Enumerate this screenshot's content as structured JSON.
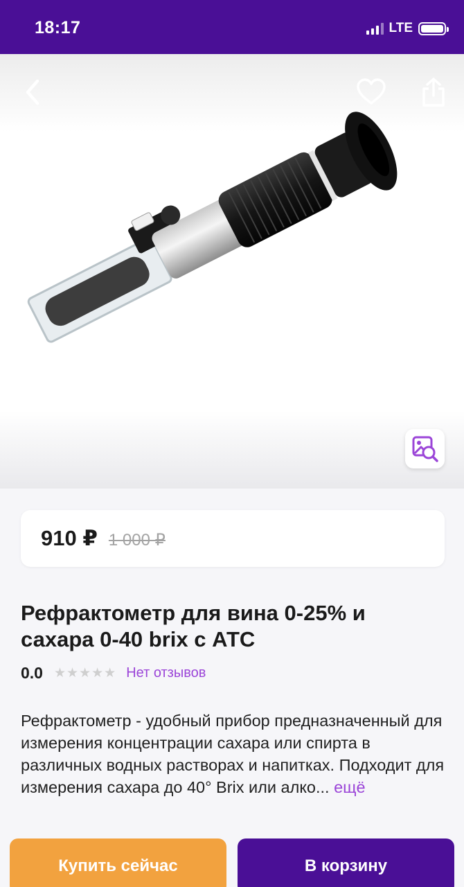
{
  "status_bar": {
    "time": "18:17",
    "network": "LTE",
    "battery_level": 1.0
  },
  "image_area": {
    "icons": {
      "back": "chevron-left-icon",
      "favorite": "heart-icon",
      "share": "share-icon",
      "visual_search": "image-search-icon"
    }
  },
  "price": {
    "current": "910 ₽",
    "old": "1 000 ₽"
  },
  "product": {
    "title": "Рефрактометр для вина 0-25% и сахара 0-40 brix с АТС",
    "rating": "0.0",
    "stars_filled": 0,
    "stars_total": 5,
    "reviews_label": "Нет отзывов",
    "description": "Рефрактометр - удобный прибор предназначенный для измерения концентрации сахара или спирта в различных водных растворах и напитках. Подходит для измерения сахара до 40° Brix или алко...",
    "more_label": "ещё"
  },
  "buttons": {
    "buy_now": "Купить сейчас",
    "add_to_cart": "В корзину"
  },
  "colors": {
    "brand_purple": "#4a0f96",
    "accent_orange": "#f2a23f",
    "link_purple": "#9b45d8"
  }
}
